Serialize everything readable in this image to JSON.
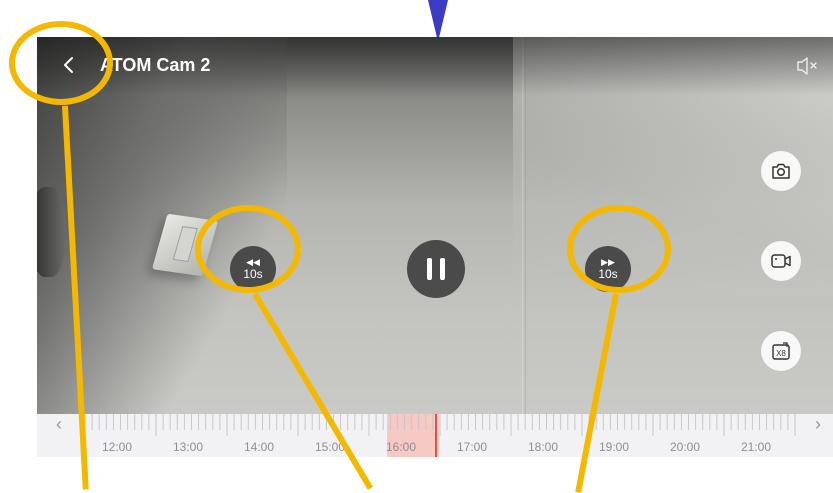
{
  "header": {
    "title": "ATOM Cam 2",
    "back_icon": "chevron-left-icon",
    "mute_icon": "speaker-mute-icon"
  },
  "controls": {
    "rewind": {
      "icon": "rewind-icon",
      "glyph": "◀◀",
      "label": "10s"
    },
    "pause": {
      "icon": "pause-icon"
    },
    "forward": {
      "icon": "fast-forward-icon",
      "glyph": "▶▶",
      "label": "10s"
    }
  },
  "side_buttons": [
    {
      "icon": "camera-icon"
    },
    {
      "icon": "video-record-icon"
    },
    {
      "icon": "speed-x8-icon",
      "label": "X8"
    }
  ],
  "timeline": {
    "prev_icon": "chevron-left-icon",
    "next_icon": "chevron-right-icon",
    "prev_glyph": "‹",
    "next_glyph": "›",
    "hours": [
      "12:00",
      "13:00",
      "14:00",
      "15:00",
      "16:00",
      "17:00",
      "18:00",
      "19:00",
      "20:00",
      "21:00"
    ],
    "highlight_color": "#f6c9c4",
    "cursor_color": "#e0533f"
  },
  "colors": {
    "annotation": "#f5b800",
    "pointer": "#3b3bc4"
  }
}
